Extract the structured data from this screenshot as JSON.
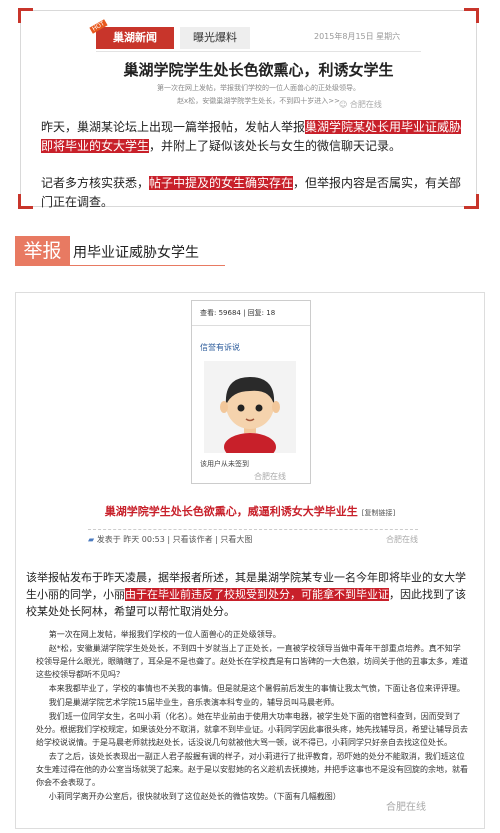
{
  "top_card": {
    "brand_tab": "巢湖新闻",
    "hot_badge": "HOT",
    "expose_tab": "曝光爆料",
    "date": "2015年8月15日 星期六",
    "headline": "巢湖学院学生处长色欲熏心，利诱女学生",
    "sub1": "第一次在网上发帖，举报我们学校的一位人面兽心的正处级领导。",
    "sub2": "赵x松，安徽巢湖学院学生处长，不到四十岁进入>>",
    "watermark": "合肥在线",
    "para1_before": "昨天，巢湖某论坛上出现一篇举报帖，发帖人举报",
    "para1_hl": "巢湖学院某处长用毕业证威胁即将毕业的女大学生",
    "para1_after": "，并附上了疑似该处长与女生的微信聊天记录。",
    "para2_before": "记者多方核实获悉，",
    "para2_hl": "帖子中提及的女生确实存在",
    "para2_after": "，但举报内容是否属实，有关部门正在调查。"
  },
  "section": {
    "badge": "举报",
    "title": "用毕业证威胁女学生"
  },
  "forum": {
    "stats": "查看: 59684 | 回复: 18",
    "link": "信誉有诉说",
    "note": "该用户从未签到",
    "watermark": "合肥在线"
  },
  "post": {
    "headline": "巢湖学院学生处长色欲熏心，威逼利诱女大学毕业生",
    "copy_link": "[复制链接]",
    "meta": "发表于 昨天 00:53 | 只看该作者 | 只看大图",
    "watermark": "合肥在线"
  },
  "body2": {
    "before": "该举报帖发布于昨天凌晨，据举报者所述，其是巢湖学院某专业一名今年即将毕业的女大学生小丽的同学，小丽",
    "hl": "由于在毕业前违反了校规受到处分，可能拿不到毕业证",
    "after": "，因此找到了该校某处处长阿林，希望可以帮忙取消处分。"
  },
  "letter": [
    "第一次在网上发帖，举报我们学校的一位人面兽心的正处级领导。",
    "赵*松，安徽巢湖学院学生处处长，不到四十岁就当上了正处长，一直被学校领导当做中青年干部重点培养。真不知学校领导是什么眼光，眼睛瞎了，耳朵是不是也聋了。赵处长在学校真是有口皆碑的一大色狼，坊间关于他的丑事太多，难道这些校领导都听不见吗？",
    "本来我都毕业了，学校的事情也不关我的事情。但是就是这个暑假前后发生的事情让我太气愤，下面让各位来评评理。",
    "我们是巢湖学院艺术学院15届毕业生，音乐表演本科专业的，辅导员叫马晨老师。",
    "我们班一位同学女生，名叫小莉（化名）。她在毕业前由于使用大功率电器，被学生处下面的宿管科查到，因而受到了处分。根据我们学校规定，如果该处分不取消，就拿不到毕业证。小莉同学因此事很头疼，她先找辅导员，希望让辅导员去给学校说说情。于是马晨老师就找赵处长，话没说几句就被他大骂一顿，说不得已，小莉同学只好亲自去找这位处长。",
    "去了之后，该处长表现出一副正人君子般握有调的样子，对小莉进行了批评教育，恐吓她的处分不能取消，我们班这位女生难过得在他的办公室当场就哭了起来。赵于是以安慰她的名义趁机去抚摸她，并把手这事也不是没有回旋的余地，就看你会不会表现了。",
    "小莉同学离开办公室后，很快就收到了这位赵处长的微信攻势。（下面有几幅截图）"
  ],
  "letter_watermark": "合肥在线",
  "colors": {
    "accent": "#c8352b",
    "highlight": "#c8202a",
    "section": "#e87a62"
  }
}
